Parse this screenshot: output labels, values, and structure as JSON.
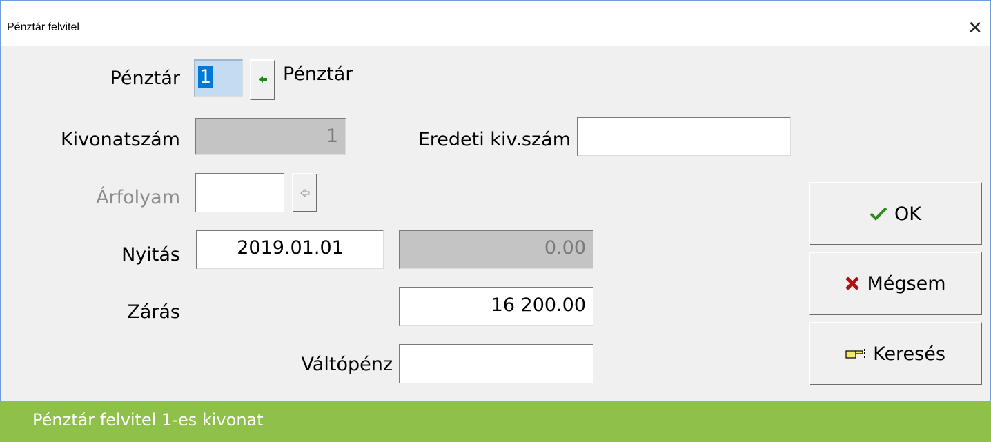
{
  "window": {
    "title": "Pénztár felvitel",
    "close_symbol": "✕"
  },
  "form": {
    "penztar_label": "Pénztár",
    "penztar_value": "1",
    "penztar_lookup_icon": "arrow-left-icon",
    "penztar_name": "Pénztár",
    "kivonatszam_label": "Kivonatszám",
    "kivonatszam_value": "1",
    "eredeti_label": "Eredeti kiv.szám",
    "eredeti_value": "",
    "arfolyam_label": "Árfolyam",
    "arfolyam_value": "",
    "arfolyam_lookup_icon": "arrow-left-outline-icon",
    "nyitas_label": "Nyitás",
    "nyitas_date": "2019.01.01",
    "nyitas_amount": "0.00",
    "zaras_label": "Zárás",
    "zaras_amount": "16 200.00",
    "valtopenz_label": "Váltópénz",
    "valtopenz_value": ""
  },
  "buttons": {
    "ok_label": "OK",
    "ok_icon": "checkmark-icon",
    "cancel_label": "Mégsem",
    "cancel_icon": "cross-icon",
    "search_label": "Keresés",
    "search_icon": "pointing-hand-icon"
  },
  "colors": {
    "status_bar": "#8fc04a",
    "ok_icon": "#2e8b1e",
    "cancel_icon": "#b01010",
    "lookup_arrow": "#1a8a1a"
  },
  "status": {
    "text": "Pénztár felvitel 1-es kivonat"
  }
}
